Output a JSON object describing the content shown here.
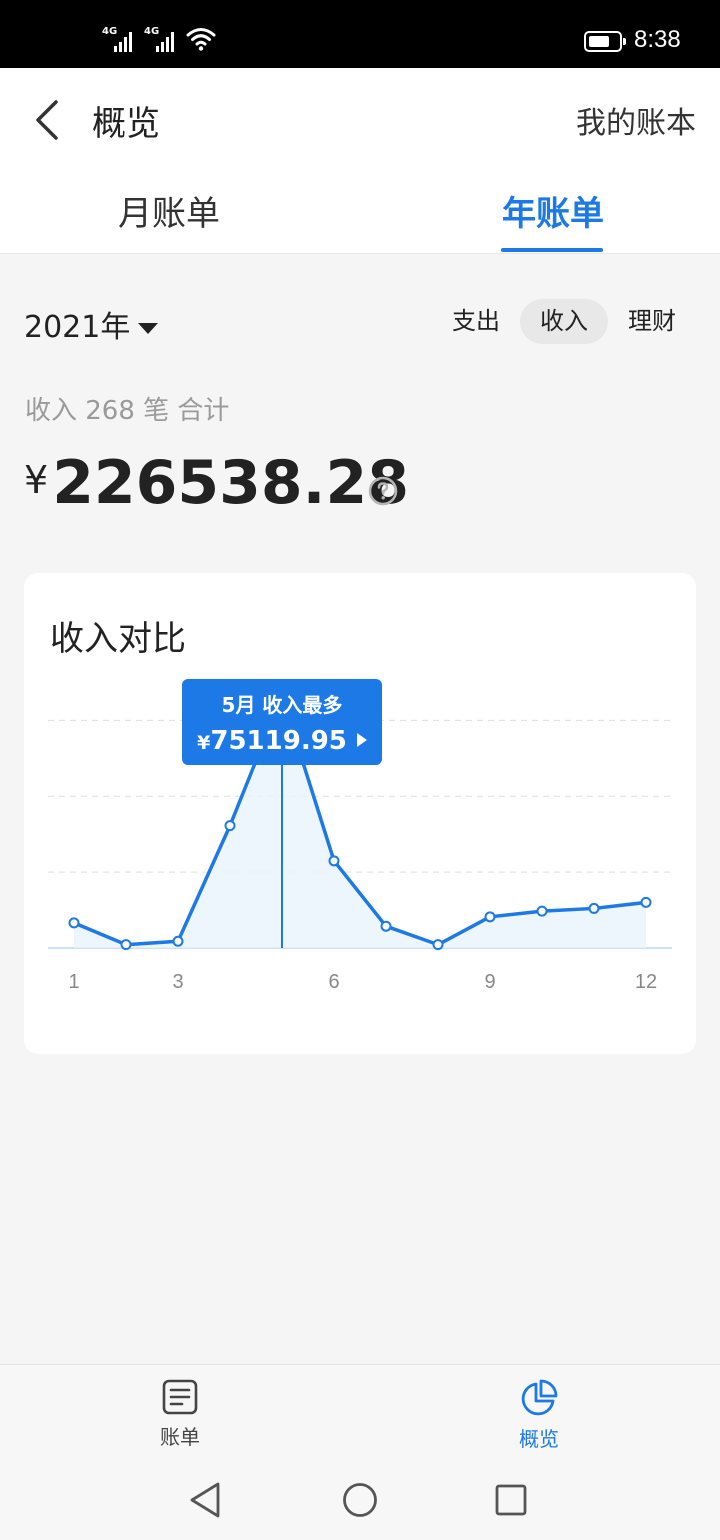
{
  "status_bar": {
    "network_1": "4G",
    "network_2": "4G",
    "time": "8:38"
  },
  "header": {
    "title": "概览",
    "right_link": "我的账本"
  },
  "tabs": [
    {
      "label": "月账单",
      "active": false
    },
    {
      "label": "年账单",
      "active": true
    }
  ],
  "filter": {
    "year": "2021年",
    "segments": [
      {
        "label": "支出"
      },
      {
        "label": "收入",
        "selected": true
      },
      {
        "label": "理财"
      }
    ]
  },
  "summary": {
    "text": "收入 268 笔 合计",
    "currency": "¥",
    "amount": "226538.28"
  },
  "card": {
    "title": "收入对比",
    "tooltip": {
      "title": "5月 收入最多",
      "currency": "¥",
      "amount": "75119.95"
    }
  },
  "chart_data": {
    "type": "area",
    "x": [
      1,
      2,
      3,
      4,
      5,
      6,
      7,
      8,
      9,
      10,
      11,
      12
    ],
    "values": [
      7500,
      1000,
      2000,
      36500,
      75119.95,
      26000,
      6500,
      1000,
      9300,
      11000,
      11800,
      13600
    ],
    "xticks": [
      "1",
      "3",
      "6",
      "9",
      "12"
    ],
    "ylim": [
      0,
      85000
    ],
    "grid": true,
    "color": "#1c79e6",
    "highlight_index": 4
  },
  "bottom_nav": [
    {
      "label": "账单",
      "icon": "bill-icon",
      "active": false
    },
    {
      "label": "概览",
      "icon": "pie-chart-icon",
      "active": true
    }
  ],
  "colors": {
    "accent": "#1c79e6",
    "background": "#f5f5f5"
  }
}
